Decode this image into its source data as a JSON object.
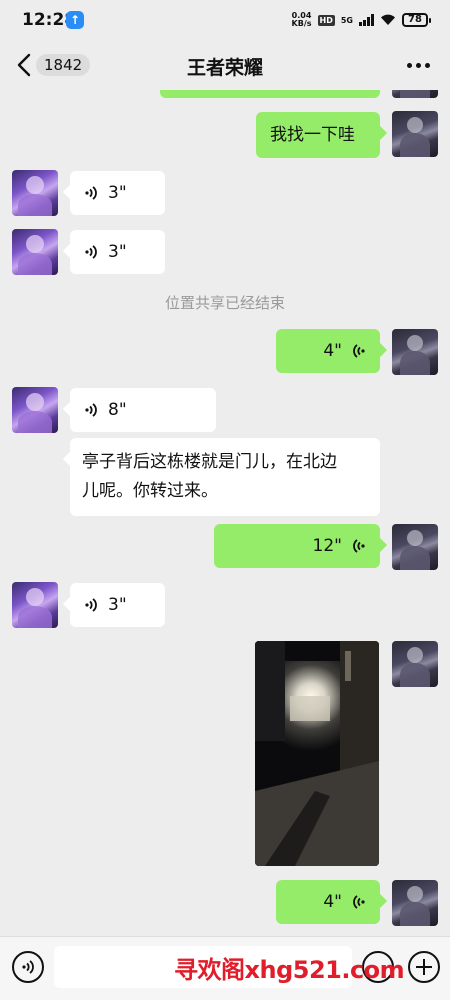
{
  "status_bar": {
    "time": "12:28",
    "net_speed": "0.04",
    "net_unit": "KB/s",
    "hd_badge": "HD",
    "network": "5G",
    "battery": "78"
  },
  "header": {
    "unread_count": "1842",
    "title": "王者荣耀"
  },
  "messages": [
    {
      "side": "right",
      "type": "text",
      "text": "我找一下哇"
    },
    {
      "side": "left",
      "type": "voice",
      "duration": "3\""
    },
    {
      "side": "left",
      "type": "voice",
      "duration": "3\""
    },
    {
      "type": "system",
      "text": "位置共享已经结束"
    },
    {
      "side": "right",
      "type": "voice",
      "duration": "4\""
    },
    {
      "side": "left",
      "type": "voice",
      "duration": "8\""
    },
    {
      "side": "left",
      "type": "text",
      "text": "亭子背后这栋楼就是门儿，在北边儿呢。你转过来。"
    },
    {
      "side": "right",
      "type": "voice",
      "duration": "12\""
    },
    {
      "side": "left",
      "type": "voice",
      "duration": "3\""
    },
    {
      "side": "right",
      "type": "image"
    },
    {
      "side": "right",
      "type": "voice",
      "duration": "4\""
    }
  ],
  "text_lines": {
    "msg7_line1": "亭子背后这栋楼就是门儿，在北边",
    "msg7_line2": "儿呢。你转过来。"
  },
  "watermark": "寻欢阁xhg521.com",
  "colors": {
    "background": "#ededed",
    "outgoing_bubble": "#95ec69",
    "incoming_bubble": "#ffffff",
    "system_text": "#9a9a9a",
    "watermark": "#e01e2b"
  },
  "icons": {
    "back": "chevron-left-icon",
    "more": "more-dots-icon",
    "voice_input": "voice-icon",
    "emoji": "emoji-icon",
    "plus": "plus-icon"
  }
}
